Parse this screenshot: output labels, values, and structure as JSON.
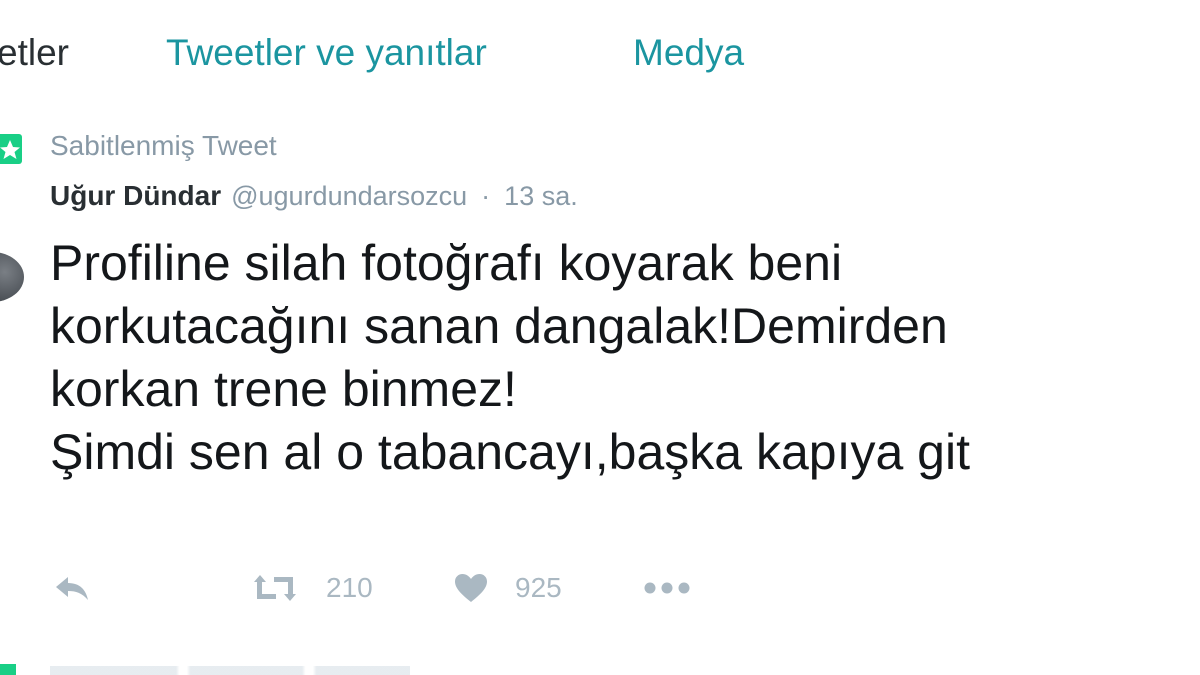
{
  "tabs": [
    {
      "label": "etler"
    },
    {
      "label": "Tweetler ve yanıtlar"
    },
    {
      "label": "Medya"
    }
  ],
  "pinned": {
    "label": "Sabitlenmiş Tweet"
  },
  "tweet": {
    "fullname": "Uğur Dündar",
    "username": "@ugurdundarsozcu",
    "separator": "·",
    "timestamp": "13 sa.",
    "lines": [
      "Profiline silah fotoğrafı koyarak beni",
      "korkutacağını sanan dangalak!Demirden",
      "korkan trene binmez!",
      "Şimdi sen al o tabancayı,başka kapıya git"
    ],
    "retweet_count": "210",
    "like_count": "925"
  },
  "colors": {
    "accent": "#1b95a0",
    "pin_icon": "#19cf86",
    "muted": "#8899a6",
    "action": "#aab8c2",
    "text": "#14171a"
  },
  "icons": {
    "pin": "pin-icon",
    "reply": "reply-icon",
    "retweet": "retweet-icon",
    "like": "heart-icon",
    "more": "more-icon"
  }
}
